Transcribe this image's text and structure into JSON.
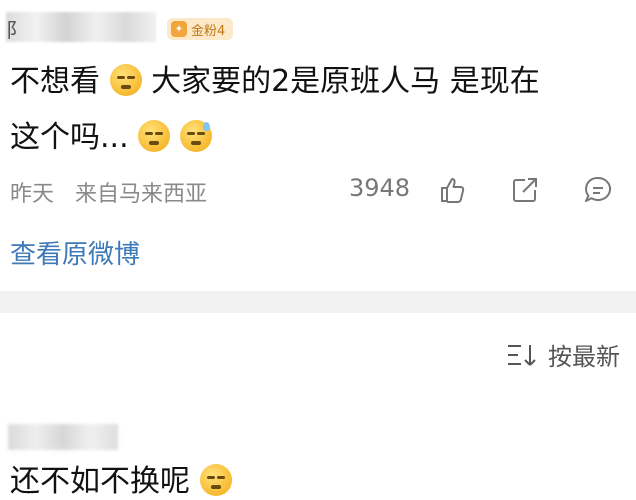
{
  "comment": {
    "author_initial": "阝",
    "fan_badge": "金粉4",
    "text_line1": "不想看",
    "text_line1b": "大家要的2是原班人马 是现在",
    "text_line2": "这个吗...",
    "time": "昨天",
    "source": "来自马来西亚",
    "likes": "3948",
    "view_original": "查看原微博"
  },
  "sort": {
    "label": "按最新"
  },
  "next_comment": {
    "text": "还不如不换呢"
  },
  "colors": {
    "link": "#3e7ab5",
    "badge_bg": "#fbe9c9",
    "badge_text": "#c07a16"
  }
}
